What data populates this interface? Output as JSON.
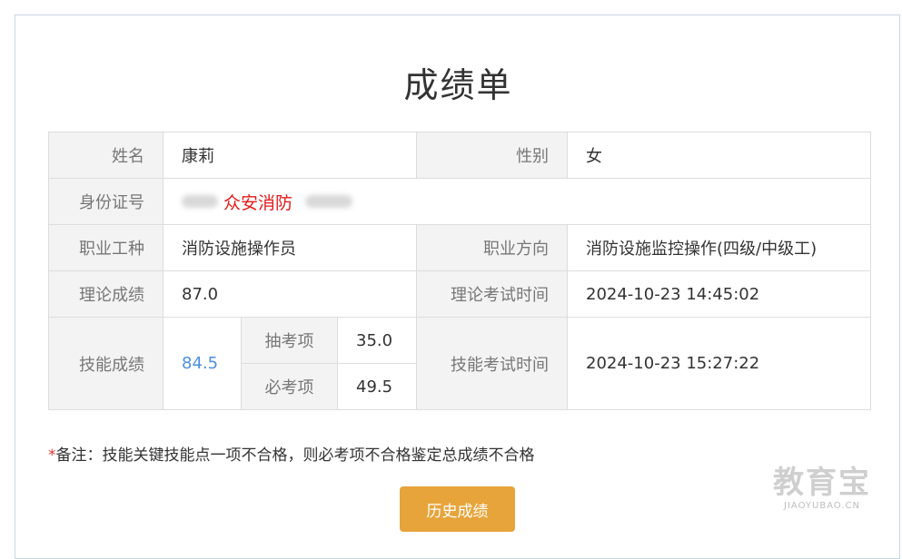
{
  "title": "成绩单",
  "table": {
    "name_label": "姓名",
    "name_value": "康莉",
    "gender_label": "性别",
    "gender_value": "女",
    "id_label": "身份证号",
    "id_watermark": "众安消防",
    "occupation_label": "职业工种",
    "occupation_value": "消防设施操作员",
    "direction_label": "职业方向",
    "direction_value": "消防设施监控操作(四级/中级工)",
    "theory_score_label": "理论成绩",
    "theory_score_value": "87.0",
    "theory_time_label": "理论考试时间",
    "theory_time_value": "2024-10-23 14:45:02",
    "skill_score_label": "技能成绩",
    "skill_score_value": "84.5",
    "sampled_item_label": "抽考项",
    "sampled_item_value": "35.0",
    "required_item_label": "必考项",
    "required_item_value": "49.5",
    "skill_time_label": "技能考试时间",
    "skill_time_value": "2024-10-23 15:27:22"
  },
  "note": {
    "asterisk": "*",
    "text": "备注：技能关键技能点一项不合格，则必考项不合格鉴定总成绩不合格"
  },
  "history_button": "历史成绩",
  "site_watermark": {
    "big": "教育宝",
    "small": "JIAOYUBAO.CN"
  },
  "colors": {
    "button": "#e7a43b",
    "link": "#4a90e2",
    "watermark_red": "#e21b1b",
    "label_bg": "#f3f3f3"
  }
}
